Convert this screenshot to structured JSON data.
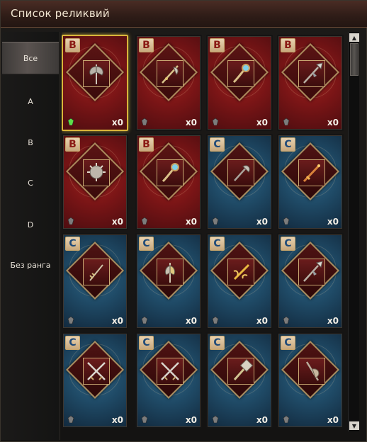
{
  "window": {
    "title": "Список реликвий"
  },
  "sidebar": {
    "items": [
      {
        "label": "Все",
        "active": true
      },
      {
        "label": "A"
      },
      {
        "label": "B"
      },
      {
        "label": "C"
      },
      {
        "label": "D"
      },
      {
        "label": "Без ранга"
      }
    ]
  },
  "relics": [
    {
      "rank": "B",
      "count": "x0",
      "icon": "double-axe-icon",
      "gem": "green",
      "selected": true
    },
    {
      "rank": "B",
      "count": "x0",
      "icon": "halberd-icon",
      "gem": "grey"
    },
    {
      "rank": "B",
      "count": "x0",
      "icon": "orb-staff-icon",
      "gem": "grey"
    },
    {
      "rank": "B",
      "count": "x0",
      "icon": "spear-icon",
      "gem": "grey"
    },
    {
      "rank": "B",
      "count": "x0",
      "icon": "spiked-mace-icon",
      "gem": "grey"
    },
    {
      "rank": "B",
      "count": "x0",
      "icon": "orb-staff-icon",
      "gem": "grey"
    },
    {
      "rank": "C",
      "count": "x0",
      "icon": "axe-icon",
      "gem": "grey"
    },
    {
      "rank": "C",
      "count": "x0",
      "icon": "flame-sword-icon",
      "gem": "grey"
    },
    {
      "rank": "C",
      "count": "x0",
      "icon": "ornate-staff-icon",
      "gem": "grey"
    },
    {
      "rank": "C",
      "count": "x0",
      "icon": "battle-axe-icon",
      "gem": "grey"
    },
    {
      "rank": "C",
      "count": "x0",
      "icon": "golden-sword-icon",
      "gem": "grey"
    },
    {
      "rank": "C",
      "count": "x0",
      "icon": "spear-icon",
      "gem": "grey"
    },
    {
      "rank": "C",
      "count": "x0",
      "icon": "crossed-swords-icon",
      "gem": "grey"
    },
    {
      "rank": "C",
      "count": "x0",
      "icon": "crossed-swords-icon",
      "gem": "grey"
    },
    {
      "rank": "C",
      "count": "x0",
      "icon": "war-hammer-icon",
      "gem": "grey"
    },
    {
      "rank": "C",
      "count": "x0",
      "icon": "round-axe-icon",
      "gem": "grey"
    }
  ],
  "scrollbar": {
    "up_glyph": "▲",
    "down_glyph": "▼"
  },
  "colors": {
    "rankB": "#7a1516",
    "rankC": "#1f4a66",
    "selected_border": "#d9b53a"
  }
}
